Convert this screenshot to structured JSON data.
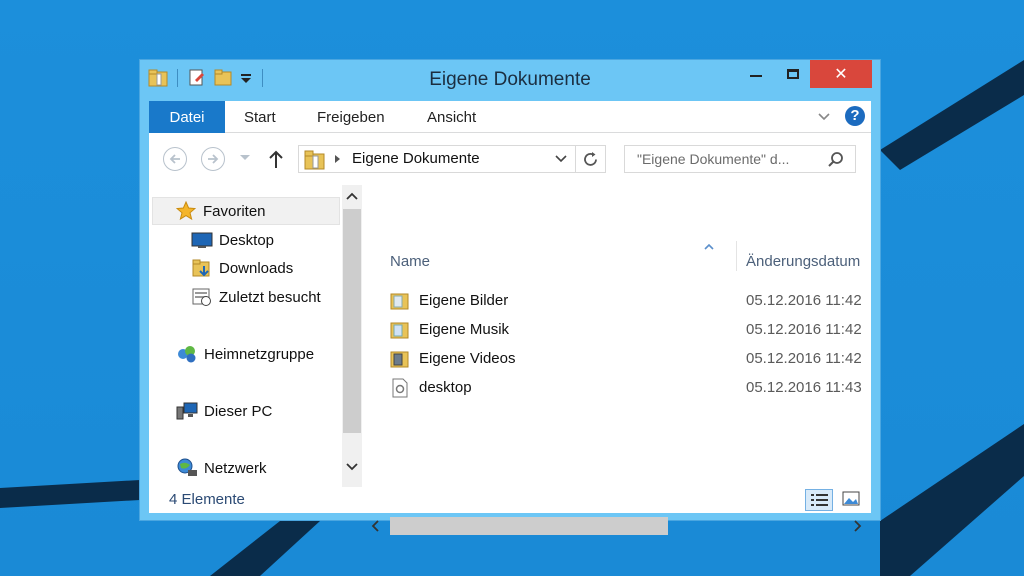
{
  "window": {
    "title": "Eigene Dokumente",
    "close_symbol": "✕"
  },
  "ribbon": {
    "tabs": [
      "Datei",
      "Start",
      "Freigeben",
      "Ansicht"
    ],
    "help_label": "?"
  },
  "address": {
    "path": "Eigene Dokumente",
    "search_placeholder": "\"Eigene Dokumente\" d..."
  },
  "nav": {
    "favorites_label": "Favoriten",
    "favorites": [
      "Desktop",
      "Downloads",
      "Zuletzt besucht"
    ],
    "homegroup": "Heimnetzgruppe",
    "this_pc": "Dieser PC",
    "network": "Netzwerk"
  },
  "columns": {
    "name": "Name",
    "date": "Änderungsdatum"
  },
  "files": [
    {
      "name": "Eigene Bilder",
      "date": "05.12.2016 11:42",
      "icon": "pictures-folder-icon"
    },
    {
      "name": "Eigene Musik",
      "date": "05.12.2016 11:42",
      "icon": "music-folder-icon"
    },
    {
      "name": "Eigene Videos",
      "date": "05.12.2016 11:42",
      "icon": "videos-folder-icon"
    },
    {
      "name": "desktop",
      "date": "05.12.2016 11:43",
      "icon": "settings-file-icon"
    }
  ],
  "status": {
    "count": "4 Elemente"
  },
  "colors": {
    "desktop": "#1a8ad6",
    "window_frame": "#6cc6f5",
    "datei_tab": "#1979ca",
    "close_button": "#d9473c"
  }
}
